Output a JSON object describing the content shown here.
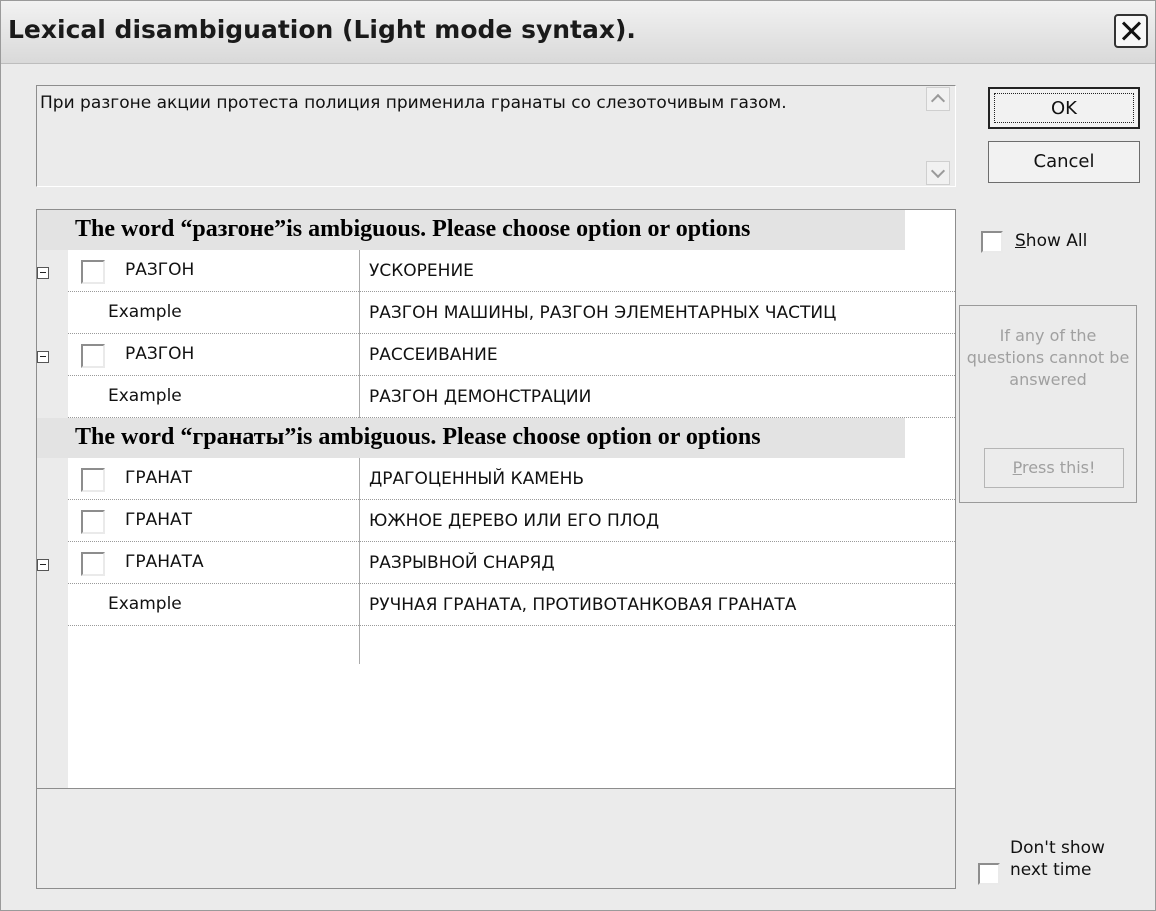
{
  "window": {
    "title": "Lexical disambiguation (Light mode syntax)."
  },
  "sentence": {
    "text": "При разгоне акции протеста полиция применила гранаты со слезоточивым газом."
  },
  "groups": [
    {
      "banner": "The word “разгоне”is ambiguous. Please choose option or options",
      "rows": [
        {
          "kind": "sense",
          "word": "РАЗГОН",
          "meaning": "УСКОРЕНИЕ",
          "expander": true
        },
        {
          "kind": "example",
          "word": "Example",
          "meaning": "РАЗГОН МАШИНЫ, РАЗГОН ЭЛЕМЕНТАРНЫХ ЧАСТИЦ"
        },
        {
          "kind": "sense",
          "word": "РАЗГОН",
          "meaning": "РАССЕИВАНИЕ",
          "expander": true
        },
        {
          "kind": "example",
          "word": "Example",
          "meaning": "РАЗГОН ДЕМОНСТРАЦИИ"
        }
      ]
    },
    {
      "banner": "The word “гранаты”is ambiguous. Please choose option or options",
      "rows": [
        {
          "kind": "sense",
          "word": "ГРАНАТ",
          "meaning": "ДРАГОЦЕННЫЙ КАМЕНЬ",
          "expander": false
        },
        {
          "kind": "sense",
          "word": "ГРАНАТ",
          "meaning": "ЮЖНОЕ ДЕРЕВО ИЛИ ЕГО ПЛОД",
          "expander": false
        },
        {
          "kind": "sense",
          "word": "ГРАНАТА",
          "meaning": "РАЗРЫВНОЙ СНАРЯД",
          "expander": true
        },
        {
          "kind": "example",
          "word": "Example",
          "meaning": "РУЧНАЯ ГРАНАТА, ПРОТИВОТАНКОВАЯ ГРАНАТА"
        }
      ]
    }
  ],
  "buttons": {
    "ok": "OK",
    "cancel": "Cancel",
    "press_this": "Press this!"
  },
  "show_all": {
    "label": "Show All",
    "checked": false
  },
  "hint": {
    "text": "If any of the questions cannot be answered"
  },
  "dont_show": {
    "label": "Don't show next time",
    "checked": false
  },
  "icons": {
    "close": "close-icon",
    "scroll_up": "scroll-up-icon",
    "scroll_down": "scroll-down-icon",
    "expander": "collapse-minus-icon"
  }
}
